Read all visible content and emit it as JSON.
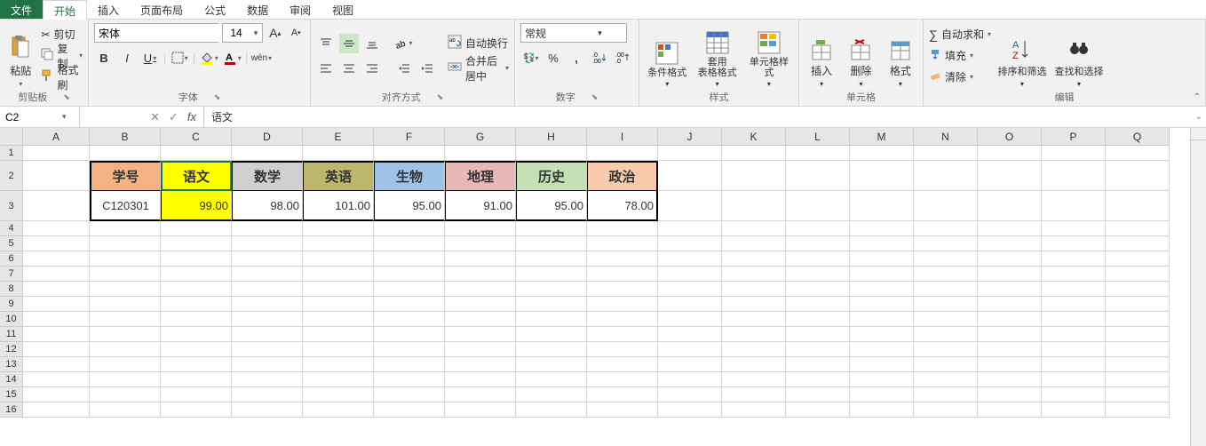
{
  "tabs": {
    "file": "文件",
    "home": "开始",
    "insert": "插入",
    "layout": "页面布局",
    "formula": "公式",
    "data": "数据",
    "review": "审阅",
    "view": "视图"
  },
  "clipboard": {
    "paste": "粘贴",
    "cut": "剪切",
    "copy": "复制",
    "format_painter": "格式刷",
    "group": "剪贴板"
  },
  "font": {
    "name": "宋体",
    "size": "14",
    "group": "字体",
    "bold": "B",
    "italic": "I",
    "underline": "U",
    "wen": "wén"
  },
  "align": {
    "group": "对齐方式",
    "wrap": "自动换行",
    "merge": "合并后居中"
  },
  "number": {
    "group": "数字",
    "format": "常规",
    "percent": "%",
    "comma": ",",
    "currency": "¥"
  },
  "styles": {
    "group": "样式",
    "cond": "条件格式",
    "table": "套用\n表格格式",
    "cell": "单元格样式"
  },
  "cells": {
    "group": "单元格",
    "insert": "插入",
    "delete": "删除",
    "format": "格式"
  },
  "editing": {
    "group": "编辑",
    "sum": "自动求和",
    "fill": "填充",
    "clear": "清除",
    "sort": "排序和筛选",
    "find": "查找和选择"
  },
  "formula_bar": {
    "cell_ref": "C2",
    "value": "语文"
  },
  "columns": [
    "A",
    "B",
    "C",
    "D",
    "E",
    "F",
    "G",
    "H",
    "I",
    "J",
    "K",
    "L",
    "M",
    "N",
    "O",
    "P",
    "Q"
  ],
  "table": {
    "headers": [
      "学号",
      "语文",
      "数学",
      "英语",
      "生物",
      "地理",
      "历史",
      "政治"
    ],
    "header_colors": [
      "#f4b183",
      "#ffff00",
      "#d0cece",
      "#bdb76b",
      "#9dc3e6",
      "#e6b9b8",
      "#c5e0b4",
      "#f8cbad"
    ],
    "row": [
      "C120301",
      "99.00",
      "98.00",
      "101.00",
      "95.00",
      "91.00",
      "95.00",
      "78.00"
    ]
  }
}
